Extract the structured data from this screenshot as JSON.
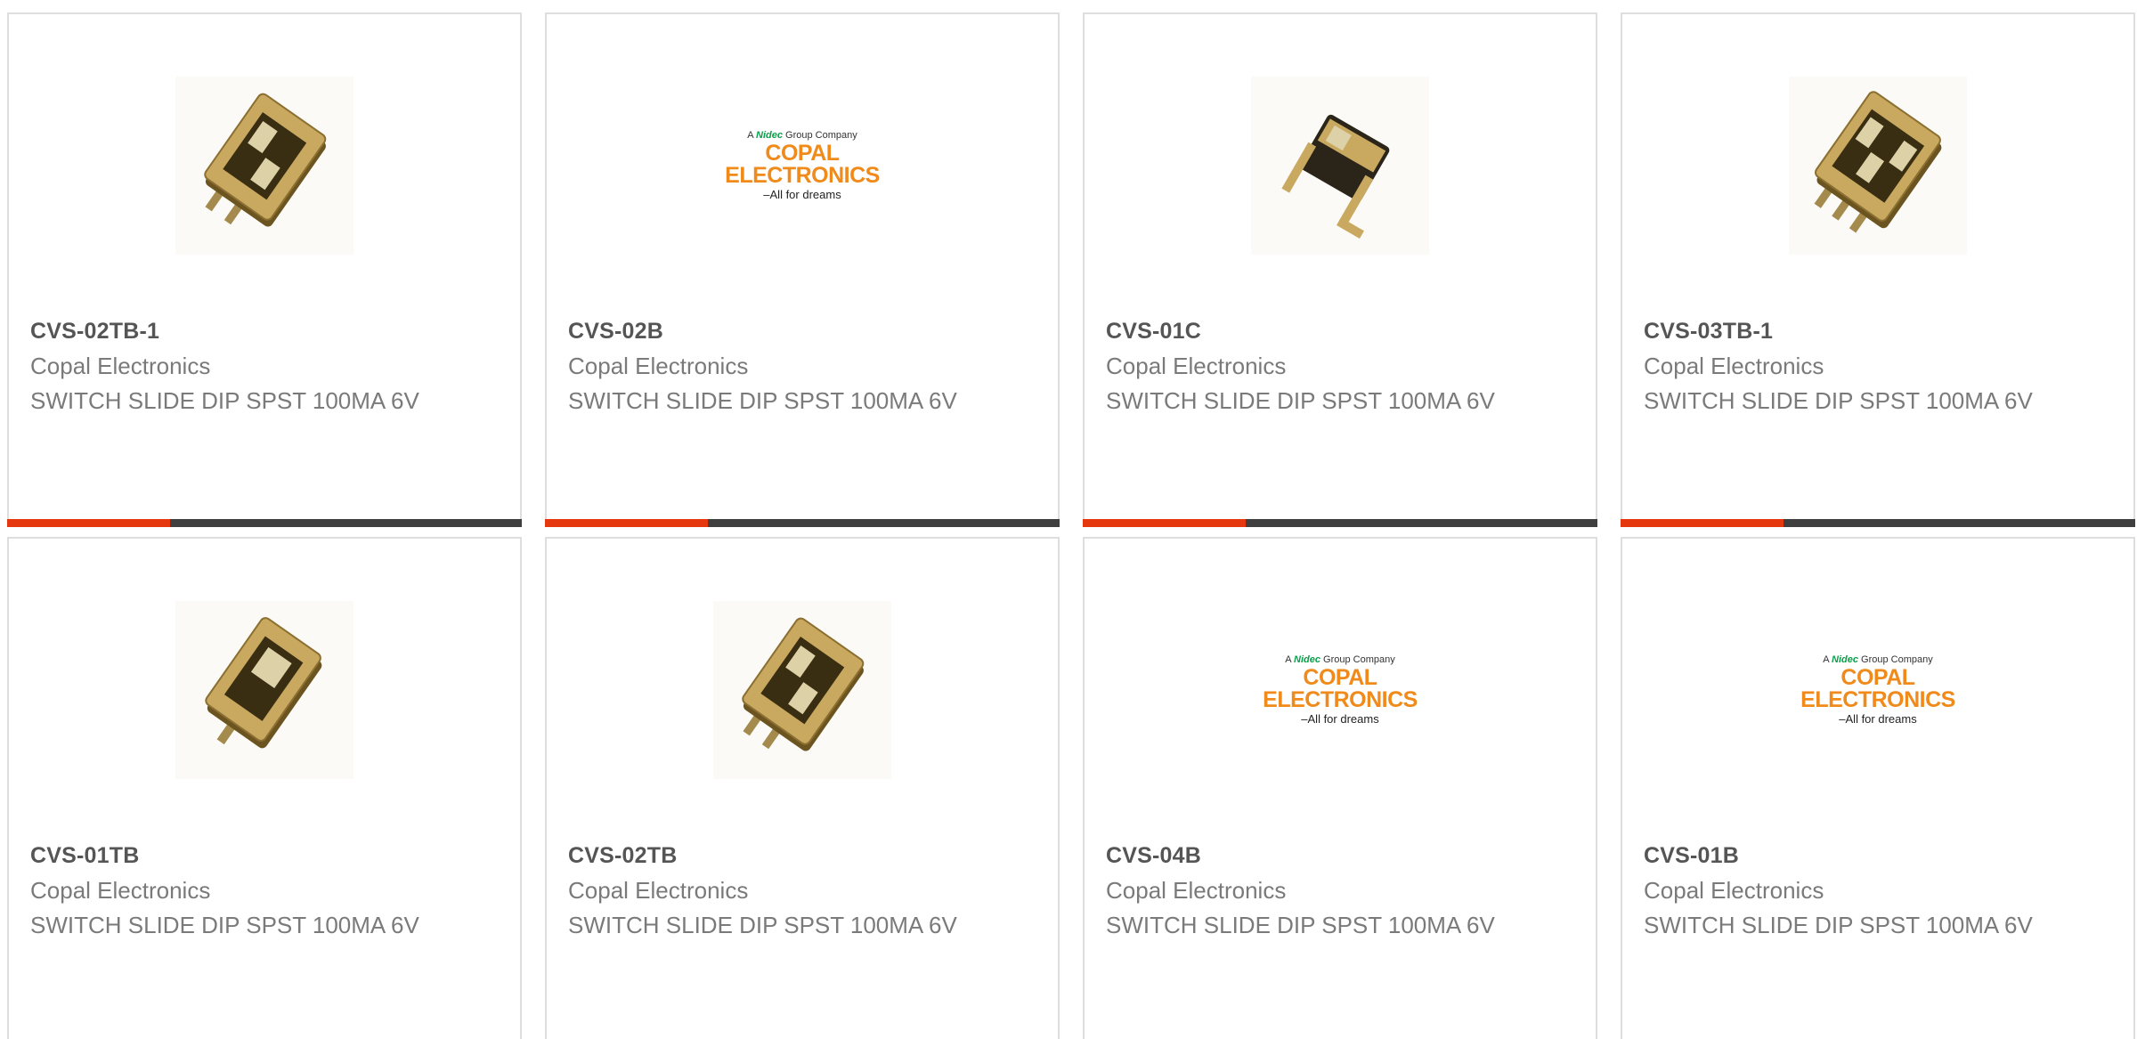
{
  "colors": {
    "accent": "#e5380f",
    "bar": "#3f3f3f",
    "logo_orange": "#f08a1a",
    "logo_green": "#0aa04a"
  },
  "logo": {
    "top_prefix": "A",
    "top_brand": "Nidec",
    "top_suffix": "Group Company",
    "main": "COPAL ELECTRONICS",
    "tagline": "–All for dreams"
  },
  "products": [
    {
      "part": "CVS-02TB-1",
      "manufacturer": "Copal Electronics",
      "description": "SWITCH SLIDE DIP SPST 100MA 6V",
      "image": "switch-2pin-icon"
    },
    {
      "part": "CVS-02B",
      "manufacturer": "Copal Electronics",
      "description": "SWITCH SLIDE DIP SPST 100MA 6V",
      "image": "copal-logo"
    },
    {
      "part": "CVS-01C",
      "manufacturer": "Copal Electronics",
      "description": "SWITCH SLIDE DIP SPST 100MA 6V",
      "image": "switch-right-angle-icon"
    },
    {
      "part": "CVS-03TB-1",
      "manufacturer": "Copal Electronics",
      "description": "SWITCH SLIDE DIP SPST 100MA 6V",
      "image": "switch-3pin-icon"
    },
    {
      "part": "CVS-01TB",
      "manufacturer": "Copal Electronics",
      "description": "SWITCH SLIDE DIP SPST 100MA 6V",
      "image": "switch-1pin-icon"
    },
    {
      "part": "CVS-02TB",
      "manufacturer": "Copal Electronics",
      "description": "SWITCH SLIDE DIP SPST 100MA 6V",
      "image": "switch-2pin-icon"
    },
    {
      "part": "CVS-04B",
      "manufacturer": "Copal Electronics",
      "description": "SWITCH SLIDE DIP SPST 100MA 6V",
      "image": "copal-logo"
    },
    {
      "part": "CVS-01B",
      "manufacturer": "Copal Electronics",
      "description": "SWITCH SLIDE DIP SPST 100MA 6V",
      "image": "copal-logo"
    }
  ]
}
